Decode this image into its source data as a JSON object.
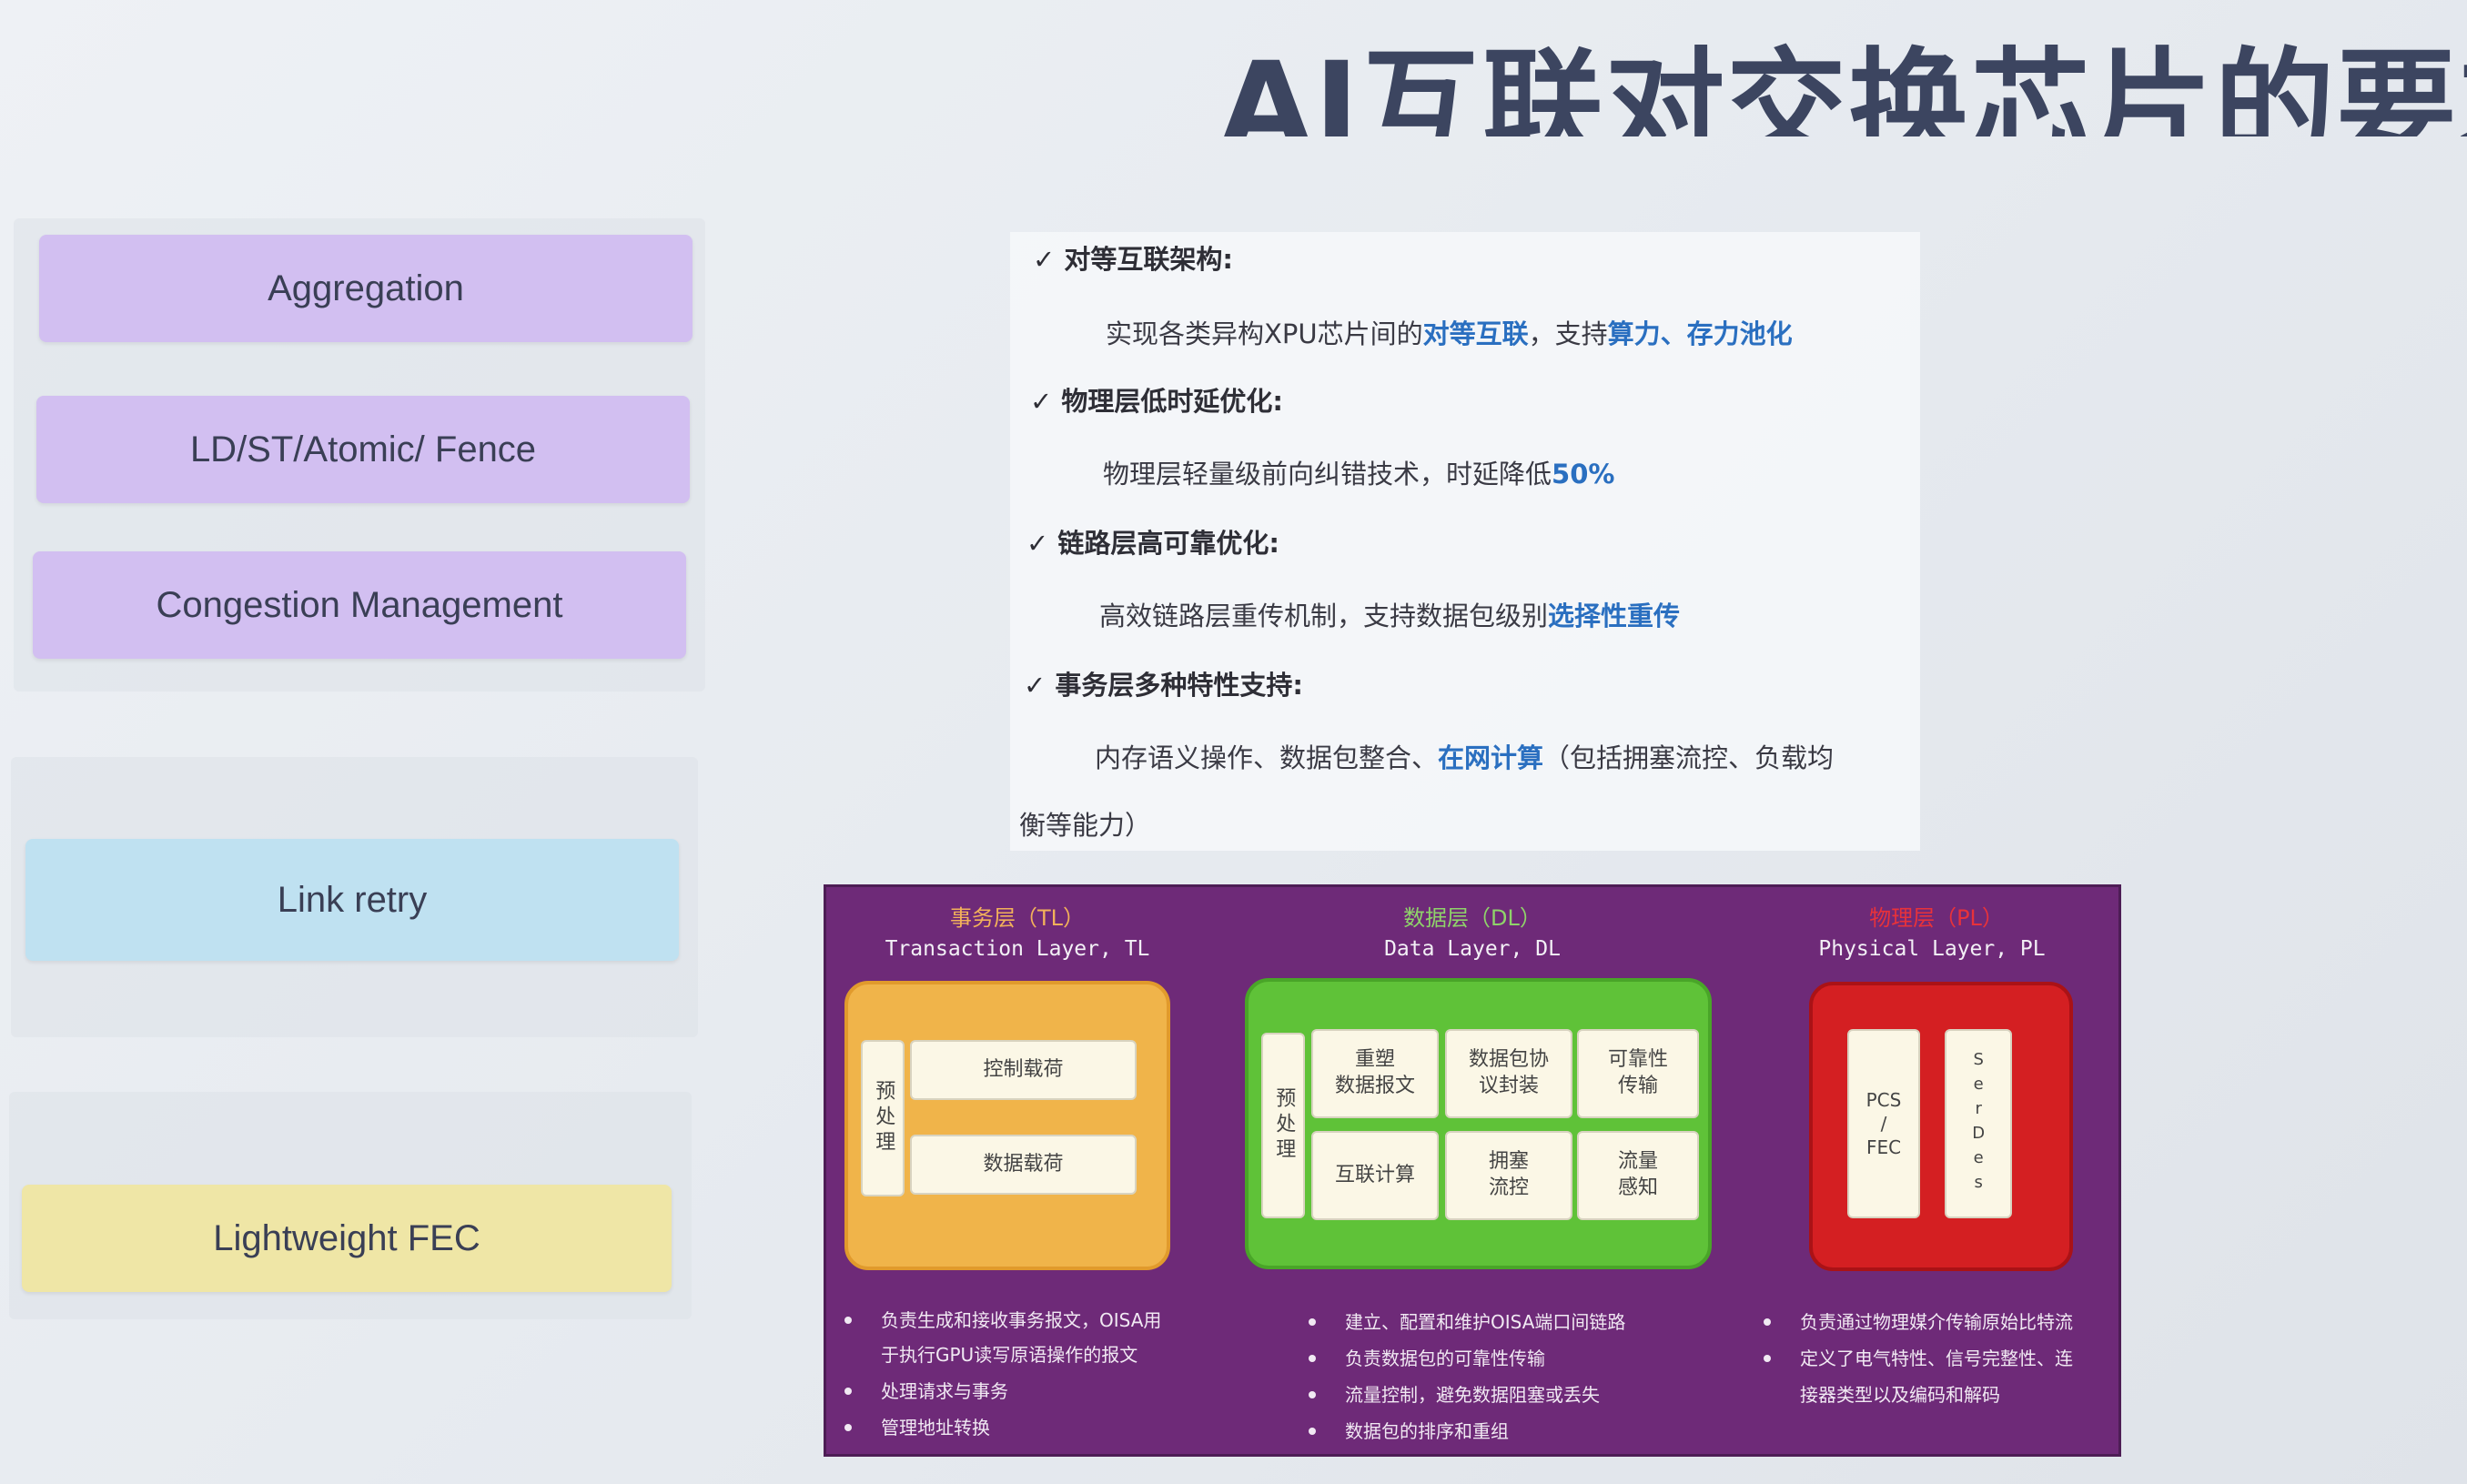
{
  "title": "AI互联对交换芯片的要求",
  "left_layers": [
    {
      "label": "Aggregation"
    },
    {
      "label": "LD/ST/Atomic/ Fence"
    },
    {
      "label": "Congestion Management"
    },
    {
      "label": "Link retry"
    },
    {
      "label": "Lightweight FEC"
    }
  ],
  "bullets": [
    {
      "check": "✓",
      "head": "对等互联架构:",
      "body_a": "实现各类异构XPU芯片间的",
      "body_hl1": "对等互联",
      "body_b": "，支持",
      "body_hl2": "算力、存力池化",
      "body_c": ""
    },
    {
      "check": "✓",
      "head": "物理层低时延优化:",
      "body_a": "物理层轻量级前向纠错技术，时延降低",
      "body_hl1": "50%",
      "body_b": "",
      "body_hl2": "",
      "body_c": ""
    },
    {
      "check": "✓",
      "head": "链路层高可靠优化:",
      "body_a": "高效链路层重传机制，支持数据包级别",
      "body_hl1": "选择性重传",
      "body_b": "",
      "body_hl2": "",
      "body_c": ""
    },
    {
      "check": "✓",
      "head": "事务层多种特性支持:",
      "body_a": "内存语义操作、数据包整合、",
      "body_hl1": "在网计算",
      "body_b": "（包括拥塞流控、负载均",
      "body_hl2": "",
      "body_c": "衡等能力）"
    }
  ],
  "diagram": {
    "columns": [
      {
        "title": "事务层（TL）",
        "subtitle": "Transaction Layer, TL",
        "title_color": "#f2b15a"
      },
      {
        "title": "数据层（DL）",
        "subtitle": "Data Layer, DL",
        "title_color": "#8fd36a"
      },
      {
        "title": "物理层（PL）",
        "subtitle": "Physical Layer, PL",
        "title_color": "#e8323a"
      }
    ],
    "tl": {
      "pre": "预处理",
      "cells": [
        "控制载荷",
        "数据载荷"
      ]
    },
    "dl": {
      "pre": "预处理",
      "cells": [
        "重塑\n数据报文",
        "数据包协\n议封装",
        "可靠性\n传输",
        "互联计算",
        "拥塞\n流控",
        "流量\n感知"
      ]
    },
    "pl": {
      "cells": [
        "PCS\n/\nFEC",
        "SerDes"
      ]
    },
    "notes": {
      "tl": [
        "负责生成和接收事务报文，OISA用",
        "于执行GPU读写原语操作的报文",
        "处理请求与事务",
        "管理地址转换"
      ],
      "dl": [
        "建立、配置和维护OISA端口间链路",
        "负责数据包的可靠性传输",
        "流量控制，避免数据阻塞或丢失",
        "数据包的排序和重组"
      ],
      "pl": [
        "负责通过物理媒介传输原始比特流",
        "定义了电气特性、信号完整性、连",
        "接器类型以及编码和解码"
      ]
    }
  },
  "colors": {
    "tl": "#f0b44a",
    "dl": "#5fc238",
    "pl": "#d41f22",
    "diagram_bg": "#6e2a78"
  }
}
